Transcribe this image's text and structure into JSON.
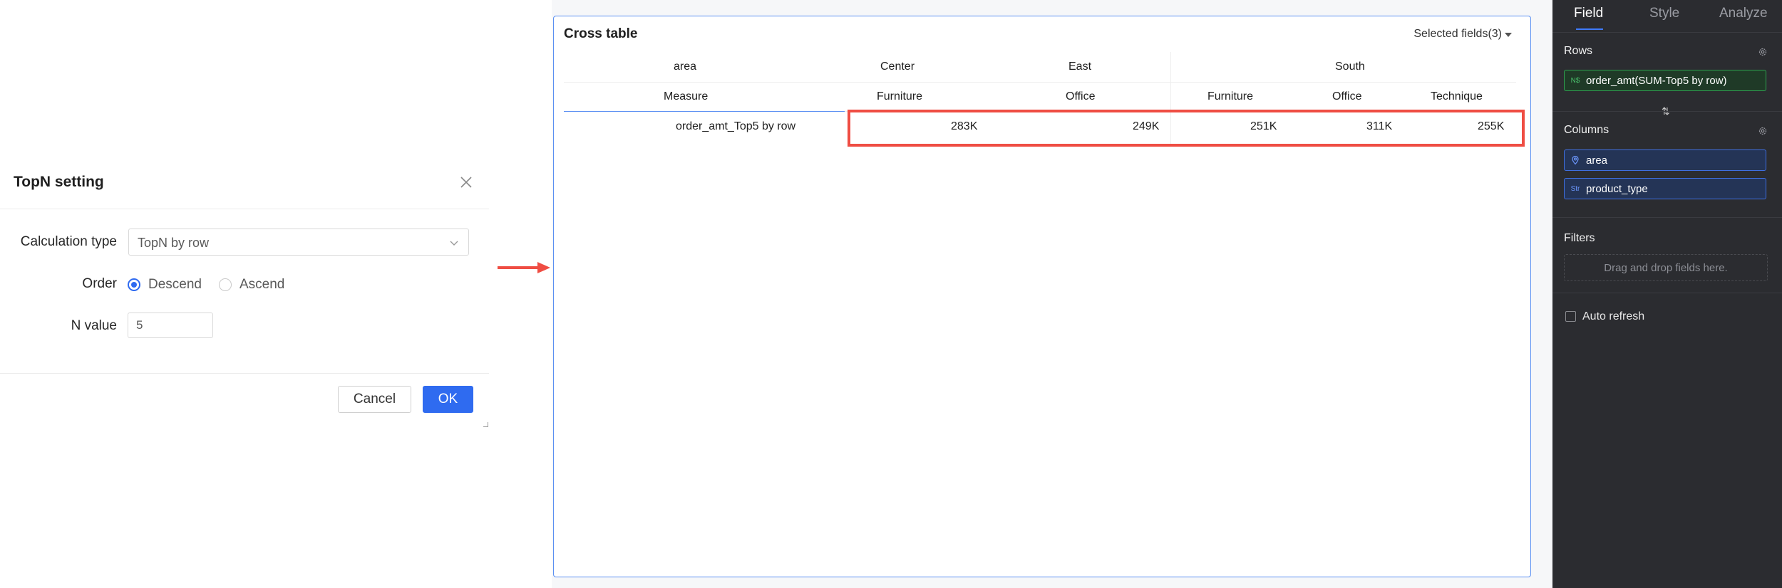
{
  "dialog": {
    "title": "TopN setting",
    "calc_type_label": "Calculation type",
    "calc_type_value": "TopN by row",
    "order_label": "Order",
    "order_options": [
      "Descend",
      "Ascend"
    ],
    "order_selected": "Descend",
    "n_label": "N value",
    "n_value": "5",
    "cancel_label": "Cancel",
    "ok_label": "OK"
  },
  "cross_table": {
    "title": "Cross table",
    "selected_fields": "Selected fields(3)",
    "header_row1": {
      "label": "area",
      "groups": [
        "Center",
        "East",
        "South"
      ]
    },
    "header_row2": {
      "label": "Measure",
      "columns": [
        "Furniture",
        "Office",
        "Furniture",
        "Office",
        "Technique"
      ]
    },
    "row": {
      "label": "order_amt_Top5 by row",
      "values": [
        "283K",
        "249K",
        "251K",
        "311K",
        "255K"
      ]
    }
  },
  "config_panel": {
    "tabs": [
      "Field",
      "Style",
      "Analyze"
    ],
    "active_tab": "Field",
    "rows_label": "Rows",
    "rows_fields": [
      {
        "icon": "N$",
        "name": "order_amt(SUM-Top5 by row)"
      }
    ],
    "swap_glyph": "⇅",
    "columns_label": "Columns",
    "columns_fields": [
      {
        "icon": "geo-icon",
        "name": "area"
      },
      {
        "icon": "Str",
        "name": "product_type"
      }
    ],
    "filters_label": "Filters",
    "filters_placeholder": "Drag and drop fields here.",
    "auto_refresh_label": "Auto refresh"
  },
  "colors": {
    "primary": "#2f6bf0",
    "highlight": "#ef4d43",
    "panel_bg": "#2b2c30",
    "measure_pill": "#2ea14f",
    "dimension_pill": "#3f6fe0"
  }
}
